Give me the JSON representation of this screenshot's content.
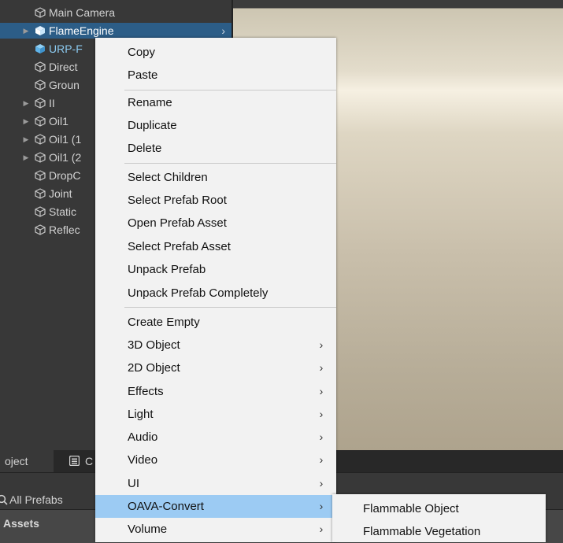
{
  "hierarchy": {
    "items": [
      {
        "label": "Main Camera",
        "expandable": false
      },
      {
        "label": "FlameEngine",
        "expandable": true,
        "selected": true
      },
      {
        "label": "URP-F",
        "expandable": false
      },
      {
        "label": "Direct",
        "expandable": false
      },
      {
        "label": "Groun",
        "expandable": false
      },
      {
        "label": "II",
        "expandable": true
      },
      {
        "label": "Oil1",
        "expandable": true
      },
      {
        "label": "Oil1 (1",
        "expandable": true
      },
      {
        "label": "Oil1 (2",
        "expandable": true
      },
      {
        "label": "DropC",
        "expandable": false
      },
      {
        "label": "Joint",
        "expandable": false
      },
      {
        "label": "Static",
        "expandable": false
      },
      {
        "label": "Reflec",
        "expandable": false
      }
    ]
  },
  "bottom": {
    "tabs": [
      {
        "label": "oject"
      },
      {
        "label": "C"
      }
    ],
    "search_label": "All Prefabs",
    "assets_label": "Assets"
  },
  "context_menu": {
    "items": [
      {
        "label": "Copy",
        "submenu": false
      },
      {
        "label": "Paste",
        "submenu": false
      },
      {
        "label": "Rename",
        "submenu": false
      },
      {
        "label": "Duplicate",
        "submenu": false
      },
      {
        "label": "Delete",
        "submenu": false
      },
      {
        "label": "Select Children",
        "submenu": false
      },
      {
        "label": "Select Prefab Root",
        "submenu": false
      },
      {
        "label": "Open Prefab Asset",
        "submenu": false
      },
      {
        "label": "Select Prefab Asset",
        "submenu": false
      },
      {
        "label": "Unpack Prefab",
        "submenu": false
      },
      {
        "label": "Unpack Prefab Completely",
        "submenu": false
      },
      {
        "label": "Create Empty",
        "submenu": false
      },
      {
        "label": "3D Object",
        "submenu": true
      },
      {
        "label": "2D Object",
        "submenu": true
      },
      {
        "label": "Effects",
        "submenu": true
      },
      {
        "label": "Light",
        "submenu": true
      },
      {
        "label": "Audio",
        "submenu": true
      },
      {
        "label": "Video",
        "submenu": true
      },
      {
        "label": "UI",
        "submenu": true
      },
      {
        "label": "OAVA-Convert",
        "submenu": true,
        "highlighted": true
      },
      {
        "label": "Volume",
        "submenu": true
      }
    ],
    "submenu_glyph": "›"
  },
  "oava_submenu": {
    "items": [
      {
        "label": "Flammable Object"
      },
      {
        "label": "Flammable Vegetation"
      }
    ]
  },
  "colors": {
    "selection": "#2c5d87",
    "menu_highlight": "#9ccbf3",
    "menu_background": "#f2f2f2",
    "prefab_cube": "#5fb3e8"
  }
}
